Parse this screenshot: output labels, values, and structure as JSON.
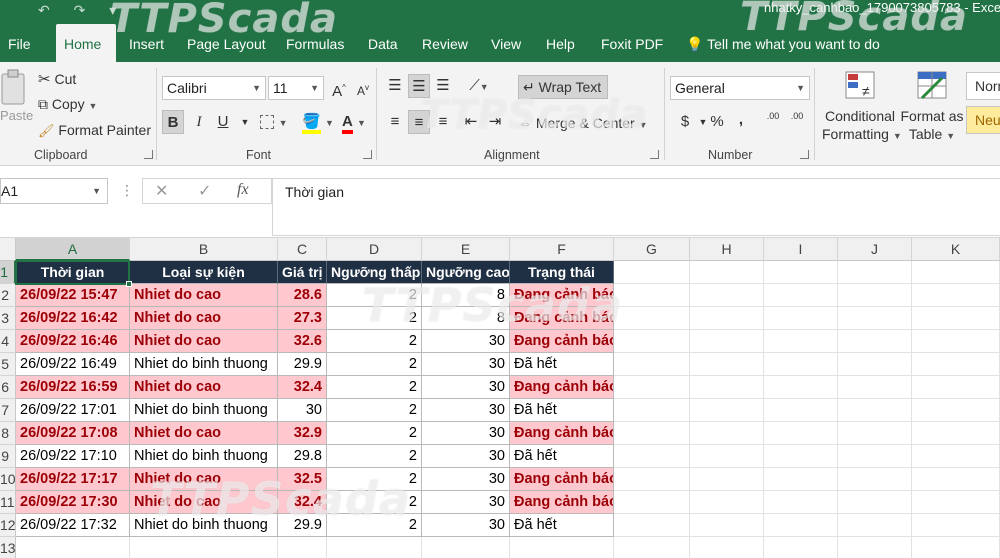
{
  "window": {
    "title": "nhatky_canhbao_1790073805783  -  Excel",
    "qat_glyphs": "↶ ↷ ▾"
  },
  "ribbon_tabs": [
    {
      "label": "File",
      "active": false
    },
    {
      "label": "Home",
      "active": true
    },
    {
      "label": "Insert",
      "active": false
    },
    {
      "label": "Page Layout",
      "active": false
    },
    {
      "label": "Formulas",
      "active": false
    },
    {
      "label": "Data",
      "active": false
    },
    {
      "label": "Review",
      "active": false
    },
    {
      "label": "View",
      "active": false
    },
    {
      "label": "Help",
      "active": false
    },
    {
      "label": "Foxit PDF",
      "active": false
    },
    {
      "label": "Tell me what you want to do",
      "active": false
    }
  ],
  "clipboard": {
    "paste": "Paste",
    "cut": "Cut",
    "copy": "Copy",
    "format_painter": "Format Painter",
    "group": "Clipboard"
  },
  "font": {
    "name": "Calibri",
    "size": "11",
    "grow": "A",
    "shrink": "A",
    "bold": "B",
    "italic": "I",
    "underline": "U",
    "group": "Font"
  },
  "alignment": {
    "wrap_text": "Wrap Text",
    "merge_center": "Merge & Center",
    "group": "Alignment"
  },
  "number": {
    "format": "General",
    "currency": "$",
    "percent": "%",
    "comma": ",",
    "inc_decimal": ".00",
    "dec_decimal": ".00",
    "group": "Number"
  },
  "styles": {
    "conditional_1": "Conditional",
    "conditional_2": "Formatting",
    "format_table_1": "Format as",
    "format_table_2": "Table",
    "normal": "Normal",
    "neutral": "Neutral"
  },
  "formula_bar": {
    "name_box": "A1",
    "cancel": "✕",
    "enter": "✓",
    "fx": "fx",
    "content": "Thời gian"
  },
  "columns": [
    "A",
    "B",
    "C",
    "D",
    "E",
    "F",
    "G",
    "H",
    "I",
    "J",
    "K"
  ],
  "rows": [
    "1",
    "2",
    "3",
    "4",
    "5",
    "6",
    "7",
    "8",
    "9",
    "10",
    "11",
    "12",
    "13"
  ],
  "table": {
    "headers": [
      "Thời gian",
      "Loại sự kiện",
      "Giá trị",
      "Ngưỡng thấp",
      "Ngưỡng cao",
      "Trạng thái"
    ],
    "rows": [
      {
        "alert": true,
        "cells": [
          "26/09/22 15:47",
          "Nhiet do cao",
          "28.6",
          "2",
          "8",
          "Đang cảnh báo"
        ]
      },
      {
        "alert": true,
        "cells": [
          "26/09/22 16:42",
          "Nhiet do cao",
          "27.3",
          "2",
          "8",
          "Đang cảnh báo"
        ]
      },
      {
        "alert": true,
        "cells": [
          "26/09/22 16:46",
          "Nhiet do cao",
          "32.6",
          "2",
          "30",
          "Đang cảnh báo"
        ]
      },
      {
        "alert": false,
        "cells": [
          "26/09/22 16:49",
          "Nhiet do binh thuong",
          "29.9",
          "2",
          "30",
          "Đã hết"
        ]
      },
      {
        "alert": true,
        "cells": [
          "26/09/22 16:59",
          "Nhiet do cao",
          "32.4",
          "2",
          "30",
          "Đang cảnh báo"
        ]
      },
      {
        "alert": false,
        "cells": [
          "26/09/22 17:01",
          "Nhiet do binh thuong",
          "30",
          "2",
          "30",
          "Đã hết"
        ]
      },
      {
        "alert": true,
        "cells": [
          "26/09/22 17:08",
          "Nhiet do cao",
          "32.9",
          "2",
          "30",
          "Đang cảnh báo"
        ]
      },
      {
        "alert": false,
        "cells": [
          "26/09/22 17:10",
          "Nhiet do binh thuong",
          "29.8",
          "2",
          "30",
          "Đã hết"
        ]
      },
      {
        "alert": true,
        "cells": [
          "26/09/22 17:17",
          "Nhiet do cao",
          "32.5",
          "2",
          "30",
          "Đang cảnh báo"
        ]
      },
      {
        "alert": true,
        "cells": [
          "26/09/22 17:30",
          "Nhiet do cao",
          "32.4",
          "2",
          "30",
          "Đang cảnh báo"
        ]
      },
      {
        "alert": false,
        "cells": [
          "26/09/22 17:32",
          "Nhiet do binh thuong",
          "29.9",
          "2",
          "30",
          "Đã hết"
        ]
      }
    ]
  },
  "watermark": "TTPScada",
  "colors": {
    "excel_green": "#217346",
    "header_fill": "#1f3044",
    "alert_fill": "#ffc7ce",
    "alert_text": "#9c0006"
  }
}
